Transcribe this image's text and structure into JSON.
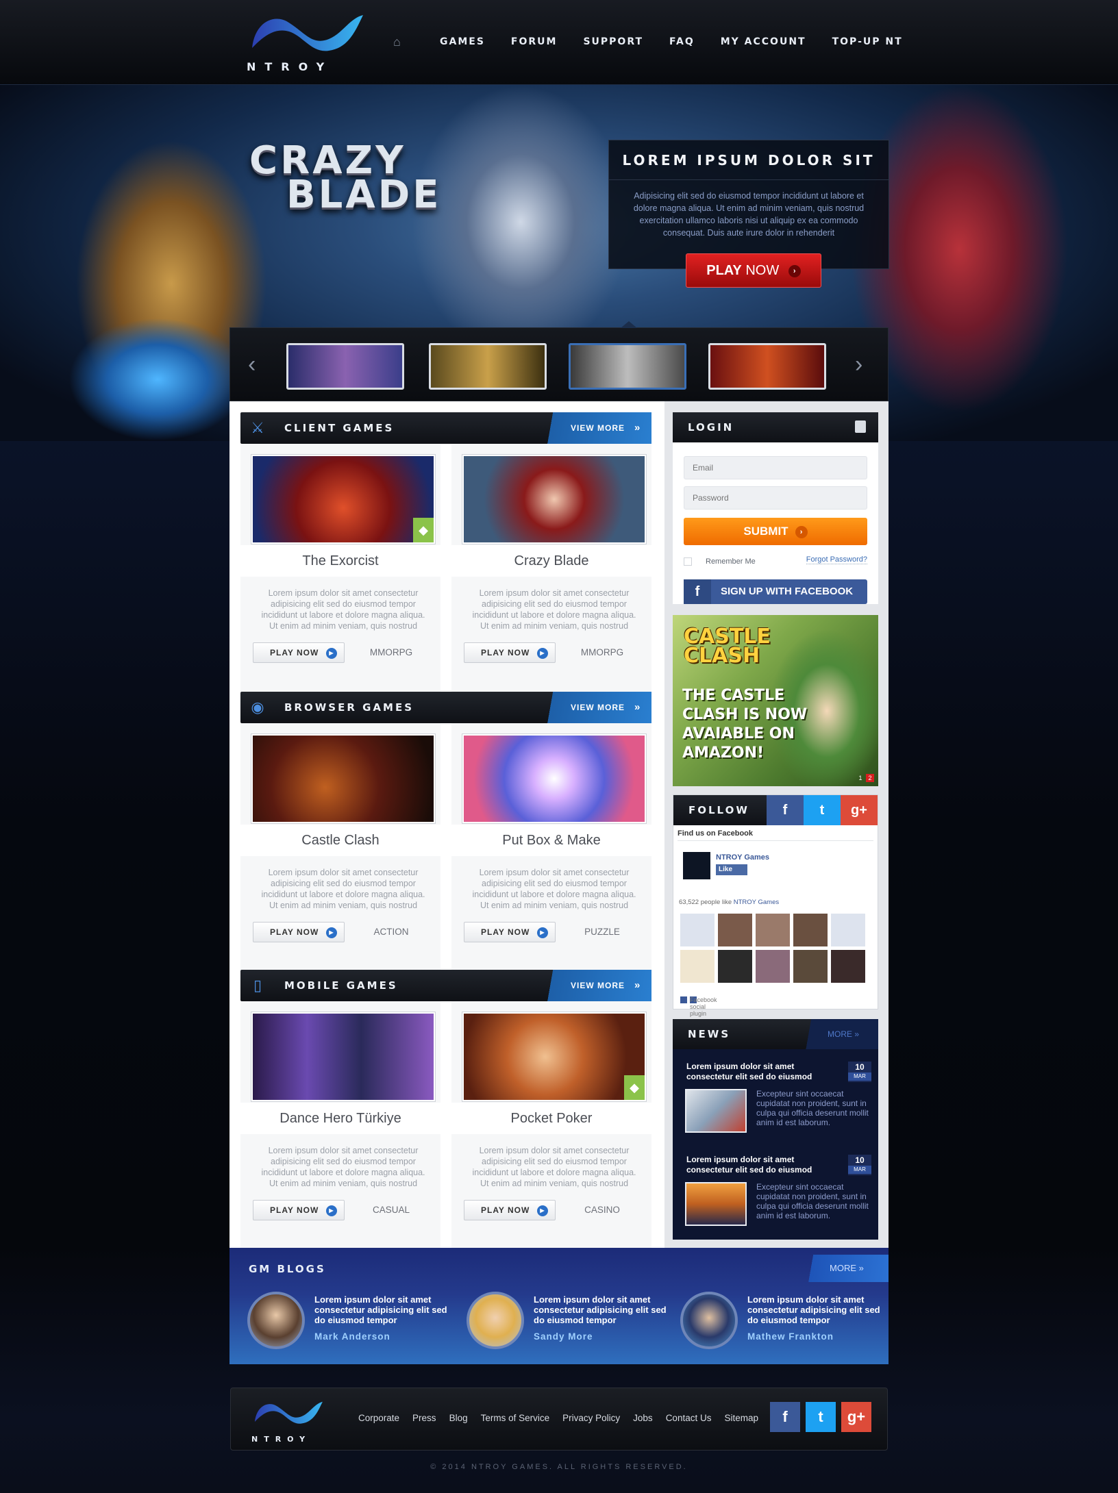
{
  "brand": {
    "name": "NTROY"
  },
  "nav": {
    "home_icon": "home-icon",
    "items": [
      "GAMES",
      "FORUM",
      "SUPPORT",
      "FAQ",
      "MY ACCOUNT",
      "TOP-UP NT"
    ]
  },
  "hero": {
    "title_line1": "CRAZY",
    "title_line2": "BLADE",
    "promo_title": "LOREM IPSUM DOLOR SIT",
    "promo_text": "Adipisicing elit sed do eiusmod tempor incididunt ut labore et dolore magna aliqua. Ut enim ad minim veniam, quis nostrud exercitation ullamco laboris nisi ut aliquip ex ea commodo consequat. Duis aute irure dolor in rehenderit",
    "play_label_bold": "PLAY",
    "play_label_light": "NOW"
  },
  "sections": [
    {
      "title": "CLIENT GAMES",
      "view_more": "VIEW MORE",
      "icon": "swords-icon",
      "games": [
        {
          "name": "The Exorcist",
          "desc": "Lorem ipsum dolor sit amet consectetur adipisicing elit sed do eiusmod tempor incididunt ut labore et dolore magna aliqua. Ut enim ad minim veniam, quis nostrud",
          "play": "PLAY NOW",
          "genre": "MMORPG",
          "android": true
        },
        {
          "name": "Crazy Blade",
          "desc": "Lorem ipsum dolor sit amet consectetur adipisicing elit sed do eiusmod tempor incididunt ut labore et dolore magna aliqua. Ut enim ad minim veniam, quis nostrud",
          "play": "PLAY NOW",
          "genre": "MMORPG",
          "android": false
        }
      ]
    },
    {
      "title": "BROWSER GAMES",
      "view_more": "VIEW MORE",
      "icon": "globe-icon",
      "games": [
        {
          "name": "Castle Clash",
          "desc": "Lorem ipsum dolor sit amet consectetur adipisicing elit sed do eiusmod tempor incididunt ut labore et dolore magna aliqua. Ut enim ad minim veniam, quis nostrud",
          "play": "PLAY NOW",
          "genre": "ACTION",
          "android": false
        },
        {
          "name": "Put Box & Make",
          "desc": "Lorem ipsum dolor sit amet consectetur adipisicing elit sed do eiusmod tempor incididunt ut labore et dolore magna aliqua. Ut enim ad minim veniam, quis nostrud",
          "play": "PLAY NOW",
          "genre": "PUZZLE",
          "android": false
        }
      ]
    },
    {
      "title": "MOBILE GAMES",
      "view_more": "VIEW MORE",
      "icon": "phone-icon",
      "games": [
        {
          "name": "Dance Hero Türkiye",
          "desc": "Lorem ipsum dolor sit amet consectetur adipisicing elit sed do eiusmod tempor incididunt ut labore et dolore magna aliqua. Ut enim ad minim veniam, quis nostrud",
          "play": "PLAY NOW",
          "genre": "CASUAL",
          "android": false
        },
        {
          "name": "Pocket Poker",
          "desc": "Lorem ipsum dolor sit amet consectetur adipisicing elit sed do eiusmod tempor incididunt ut labore et dolore magna aliqua. Ut enim ad minim veniam, quis nostrud",
          "play": "PLAY NOW",
          "genre": "CASINO",
          "android": true
        }
      ]
    }
  ],
  "login": {
    "title": "LOGIN",
    "email_placeholder": "Email",
    "password_placeholder": "Password",
    "submit": "SUBMIT",
    "remember": "Remember Me",
    "forgot": "Forgot Password?",
    "facebook": "SIGN UP WITH FACEBOOK"
  },
  "ad": {
    "logo_line1": "CASTLE",
    "logo_line2": "CLASH",
    "text": "THE CASTLE CLASH IS NOW AVAIABLE ON AMAZON!",
    "page1": "1",
    "page2": "2"
  },
  "follow": {
    "title": "FOLLOW",
    "find_us": "Find us on Facebook",
    "page_name": "NTROY Games",
    "like": "Like",
    "count_prefix": "63,522 people like",
    "count_page": "NTROY Games",
    "plugin": "Facebook social plugin"
  },
  "news": {
    "title": "NEWS",
    "more": "MORE",
    "items": [
      {
        "headline": "Lorem ipsum dolor sit amet consectetur elit sed do eiusmod",
        "day": "10",
        "month": "MAR",
        "body": "Excepteur sint occaecat cupidatat non proident, sunt in culpa qui officia deserunt mollit anim id est laborum."
      },
      {
        "headline": "Lorem ipsum dolor sit amet consectetur elit sed do eiusmod",
        "day": "10",
        "month": "MAR",
        "body": "Excepteur sint occaecat cupidatat non proident, sunt in culpa qui officia deserunt mollit anim id est laborum."
      }
    ]
  },
  "blogs": {
    "title": "GM BLOGS",
    "more": "MORE",
    "items": [
      {
        "text": "Lorem ipsum dolor sit amet consectetur adipisicing elit sed do eiusmod tempor",
        "author": "Mark Anderson"
      },
      {
        "text": "Lorem ipsum dolor sit amet consectetur adipisicing elit sed do eiusmod tempor",
        "author": "Sandy More"
      },
      {
        "text": "Lorem ipsum dolor sit amet consectetur adipisicing elit sed do eiusmod tempor",
        "author": "Mathew Frankton"
      }
    ]
  },
  "footer": {
    "links": [
      "Corporate",
      "Press",
      "Blog",
      "Terms of Service",
      "Privacy Policy",
      "Jobs",
      "Contact Us",
      "Sitemap"
    ],
    "copyright": "© 2014 NTROY GAMES. ALL RIGHTS RESERVED."
  },
  "colors": {
    "accent_blue": "#2a7fd0",
    "play_red": "#d81a1a",
    "submit_orange": "#f57c00",
    "facebook": "#3b5998",
    "twitter": "#1da1f2",
    "google": "#dd4b39",
    "android": "#8bc34a"
  }
}
